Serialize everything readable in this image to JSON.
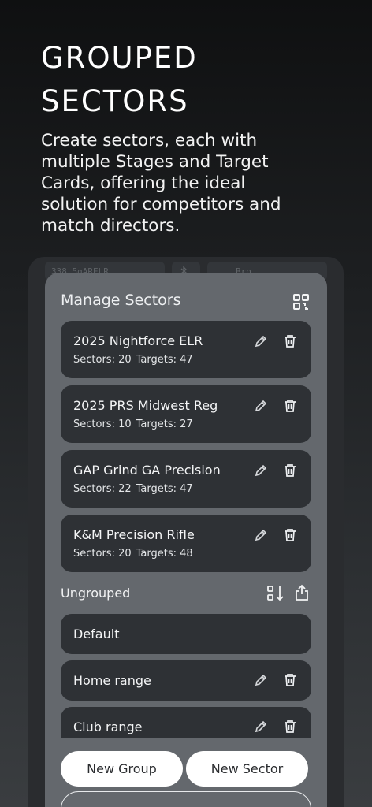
{
  "headline": "GROUPED\nSECTORS",
  "subtext": "Create sectors, each with multiple Stages and Target Cards, offering the ideal solution for competitors and match directors.",
  "background_chips": [
    "338 5gARELR",
    "Bro"
  ],
  "sheet": {
    "title": "Manage Sectors",
    "groups": [
      {
        "name": "2025 Nightforce ELR",
        "sectors_label": "Sectors: 20",
        "targets_label": "Targets: 47"
      },
      {
        "name": "2025 PRS Midwest Reg",
        "sectors_label": "Sectors: 10",
        "targets_label": "Targets: 27"
      },
      {
        "name": "GAP Grind GA Precision",
        "sectors_label": "Sectors: 22",
        "targets_label": "Targets: 47"
      },
      {
        "name": "K&M Precision Rifle",
        "sectors_label": "Sectors: 20",
        "targets_label": "Targets: 48"
      }
    ],
    "ungrouped_label": "Ungrouped",
    "ungrouped": [
      {
        "name": "Default"
      },
      {
        "name": "Home range"
      },
      {
        "name": "Club range"
      }
    ],
    "new_group_label": "New Group",
    "new_sector_label": "New Sector"
  },
  "colors": {
    "sheet": "#64686d",
    "card": "#2e3135",
    "button": "#ffffff"
  },
  "icons": [
    "qr-code-icon",
    "pencil-icon",
    "trash-icon",
    "sort-icon",
    "share-icon"
  ]
}
